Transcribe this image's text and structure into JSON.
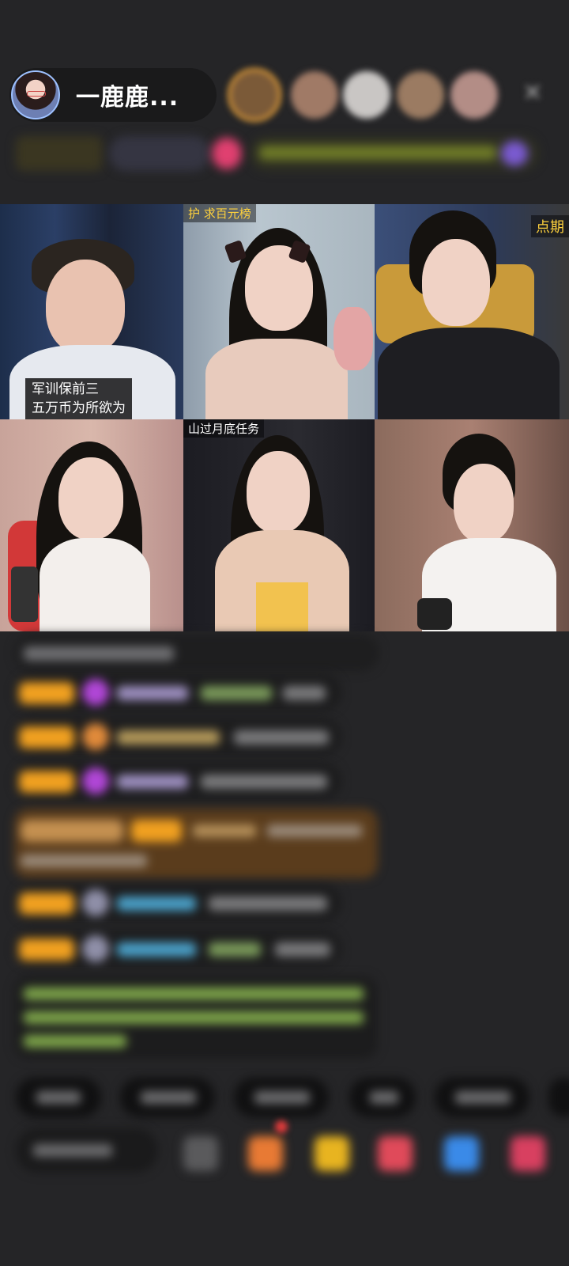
{
  "header": {
    "host_name": "一鹿鹿...",
    "close_icon": "close-icon"
  },
  "video_tiles": {
    "tile1_caption_line1": "军训保前三",
    "tile1_caption_line2": "五万币为所欲为",
    "tile2_top_tag": "护 求百元榜",
    "tile3_top_tag": "点期",
    "tile5_top_tag": "山过月底任务"
  },
  "colors": {
    "background": "#252527",
    "badge_orange": "#f0a020",
    "accent_yellow": "#ffd23d"
  }
}
